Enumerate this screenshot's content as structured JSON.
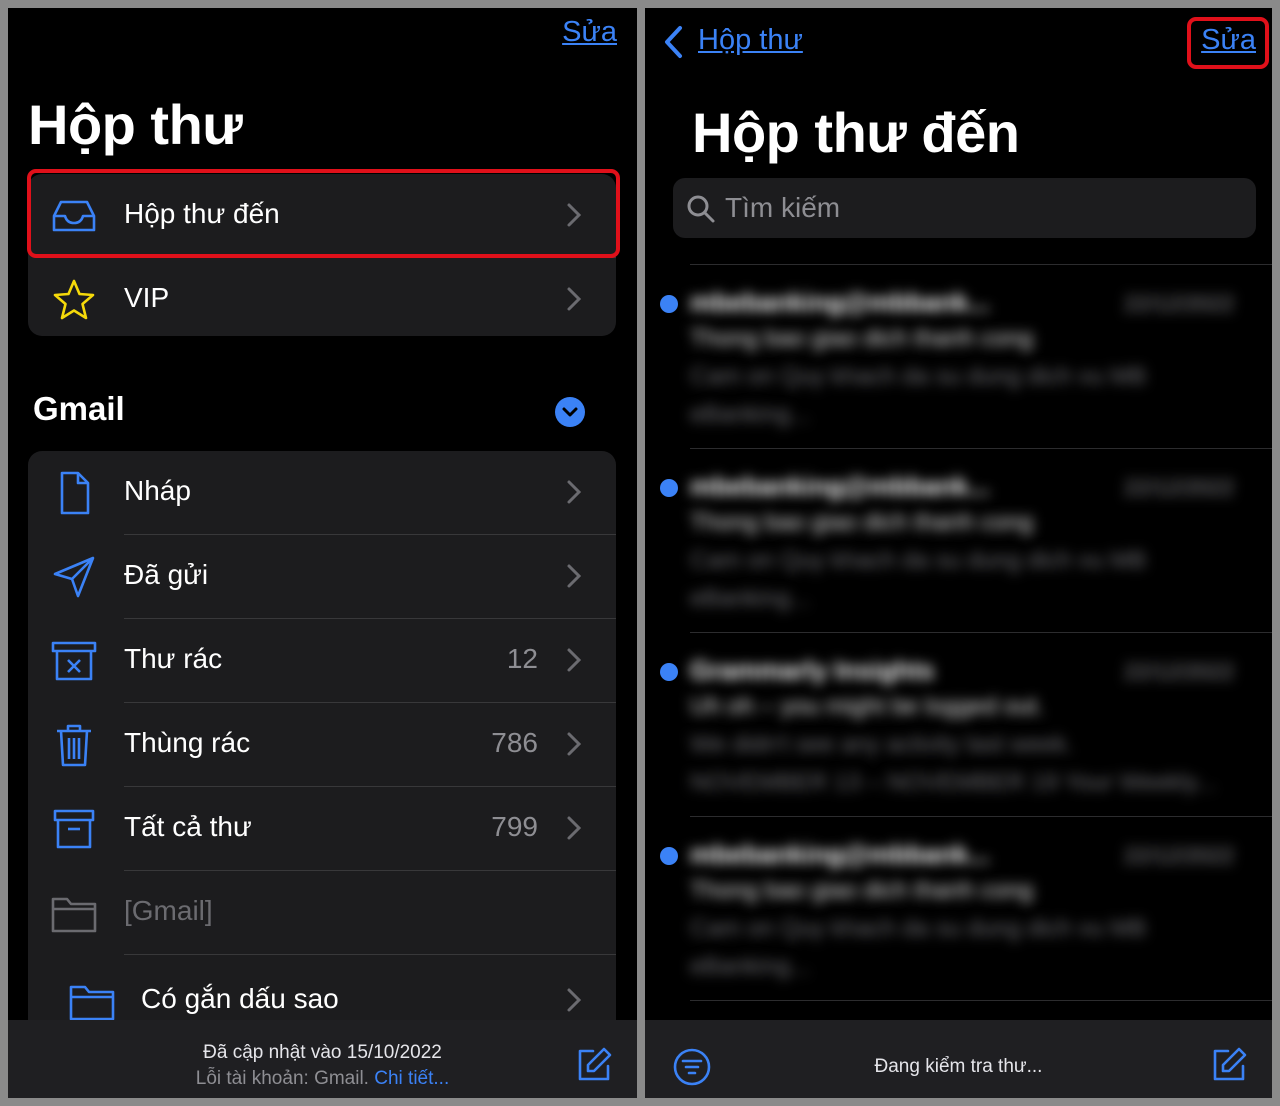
{
  "left": {
    "edit_label": "Sửa",
    "title": "Hộp thư",
    "top_items": [
      {
        "label": "Hộp thư đến",
        "icon": "inbox-tray-icon"
      },
      {
        "label": "VIP",
        "icon": "star-icon"
      }
    ],
    "gmail": {
      "section_title": "Gmail",
      "items": [
        {
          "label": "Nháp",
          "count": "",
          "icon": "document-icon"
        },
        {
          "label": "Đã gửi",
          "count": "",
          "icon": "paper-plane-icon"
        },
        {
          "label": "Thư rác",
          "count": "12",
          "icon": "junk-box-icon"
        },
        {
          "label": "Thùng rác",
          "count": "786",
          "icon": "trash-icon"
        },
        {
          "label": "Tất cả thư",
          "count": "799",
          "icon": "archive-box-icon"
        },
        {
          "label": "[Gmail]",
          "count": "",
          "icon": "folder-icon"
        },
        {
          "label": "Có gắn dấu sao",
          "count": "",
          "icon": "folder-icon"
        }
      ]
    },
    "status": {
      "updated": "Đã cập nhật vào 15/10/2022",
      "error_prefix": "Lỗi tài khoản: Gmail.",
      "error_link": "Chi tiết..."
    }
  },
  "right": {
    "back_label": "Hộp thư",
    "edit_label": "Sửa",
    "title": "Hộp thư đến",
    "search_placeholder": "Tìm kiếm",
    "messages": [
      {
        "from": "mbebanking@mbbank...",
        "date": "22/12/2022",
        "subject": "Thong bao giao dich thanh cong",
        "preview1": "Cam on Quy khach da su dung dich vu MB",
        "preview2": "eBanking..."
      },
      {
        "from": "mbebanking@mbbank...",
        "date": "22/12/2022",
        "subject": "Thong bao giao dich thanh cong",
        "preview1": "Cam on Quy khach da su dung dich vu MB",
        "preview2": "eBanking..."
      },
      {
        "from": "Grammarly Insights",
        "date": "22/12/2022",
        "subject": "Uh oh – you might be logged out.",
        "preview1": "We didn't see any activity last week.",
        "preview2": "NOVEMBER 13 – NOVEMBER 19 Your Weekly..."
      },
      {
        "from": "mbebanking@mbbank...",
        "date": "22/12/2022",
        "subject": "Thong bao giao dich thanh cong",
        "preview1": "Cam on Quy khach da su dung dich vu MB",
        "preview2": "eBanking..."
      }
    ],
    "status": "Đang kiểm tra thư..."
  },
  "colors": {
    "accent": "#3b82f6",
    "highlight": "#e0101a",
    "background": "#000000",
    "group": "#1c1c1e"
  }
}
